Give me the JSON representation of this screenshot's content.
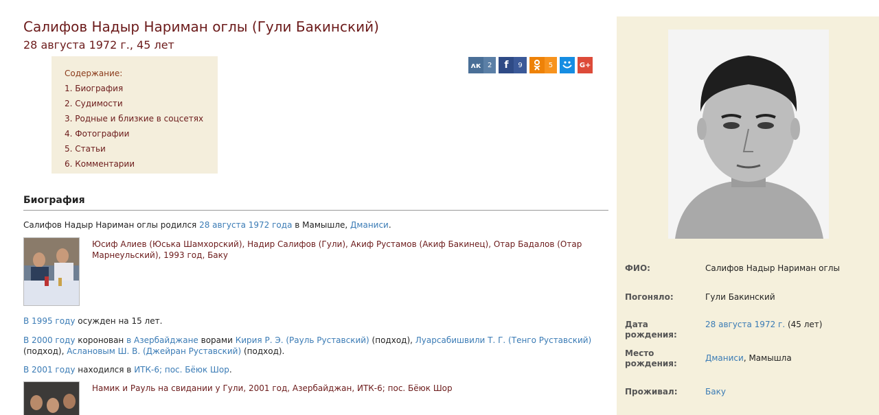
{
  "header": {
    "title": "Салифов Надыр Нариман оглы (Гули Бакинский)",
    "subtitle": "28 августа 1972 г., 45 лет"
  },
  "toc": {
    "title": "Содержание:",
    "items": [
      "1. Биография",
      "2. Судимости",
      "3. Родные и близкие в соцсетях",
      "4. Фотографии",
      "5. Статьи",
      "6. Комментарии"
    ]
  },
  "share": [
    {
      "name": "vk",
      "icon": "vk-icon",
      "glyph": "ʌк",
      "count": "2",
      "color": "#5b7fa6"
    },
    {
      "name": "facebook",
      "icon": "facebook-icon",
      "glyph": "f",
      "count": "9",
      "color": "#3b5998"
    },
    {
      "name": "odnoklassniki",
      "icon": "odnoklassniki-icon",
      "glyph": "ǫ",
      "count": "5",
      "color": "#f7931e"
    },
    {
      "name": "moimir",
      "icon": "moimir-icon",
      "glyph": "◡",
      "count": "",
      "color": "#168de2"
    },
    {
      "name": "googleplus",
      "icon": "googleplus-icon",
      "glyph": "G+",
      "count": "",
      "color": "#dd4b39"
    }
  ],
  "bio": {
    "heading": "Биография",
    "p1": {
      "t1": "Салифов Надыр Нариман оглы родился ",
      "l1": "28 августа 1972 года",
      "t2": " в Мамышле, ",
      "l2": "Дманиси",
      "t3": "."
    },
    "photo1_caption": "Юсиф Алиев (Юська Шамхорский), Надир Салифов (Гули), Акиф Рустамов (Акиф Бакинец), Отар Бадалов (Отар Марнеульский), 1993 год, Баку",
    "p2": {
      "l1": "В 1995 году",
      "t1": " осужден на 15 лет."
    },
    "p3": {
      "l1": "В 2000 году",
      "t1": " коронован ",
      "l2": "в Азербайджане",
      "t2": " ворами ",
      "l3": "Кирия Р. Э. (Рауль Руставский)",
      "t3": " (подход), ",
      "l4": "Луарсабишвили Т. Г. (Тенго Руставский)",
      "t4": " (подход), ",
      "l5": "Аслановым Ш. В. (Джейран Руставский)",
      "t5": " (подход)."
    },
    "p4": {
      "l1": "В 2001 году",
      "t1": " находился в ",
      "l2": "ИТК-6; пос. Бёюк Шор",
      "t2": "."
    },
    "photo2_caption": "Намик и Рауль на свидании у Гули, 2001 год, Азербайджан, ИТК-6; пос. Бёюк Шор"
  },
  "profile": {
    "fio_label": "ФИО:",
    "fio_value": "Салифов Надыр Нариман оглы",
    "nickname_label": "Погоняло:",
    "nickname_value": "Гули Бакинский",
    "birthdate_label": "Дата рождения:",
    "birthdate_link": "28 августа 1972 г.",
    "birthdate_extra": " (45 лет)",
    "birthplace_label": "Место рождения:",
    "birthplace_link": "Дманиси",
    "birthplace_extra": ", Мамышла",
    "residence_label": "Проживал:",
    "residence_link": "Баку"
  },
  "colors": {
    "accent": "#6b1a1a",
    "link": "#3a7bb5",
    "sidebar_bg": "#f5f0dc",
    "toc_bg": "#f4eedc"
  }
}
